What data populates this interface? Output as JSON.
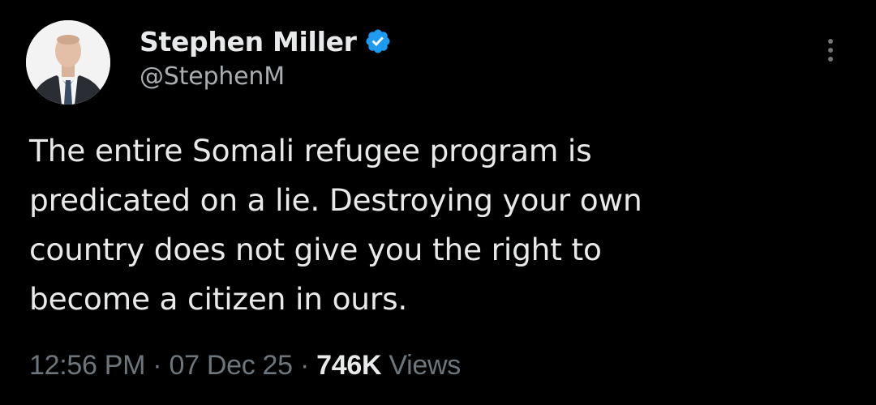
{
  "tweet": {
    "author": {
      "display_name": "Stephen Miller",
      "handle": "@StephenM",
      "verified": true,
      "verified_icon": "verified-badge-icon",
      "verified_color": "#1d9bf0"
    },
    "text_lines": [
      "The entire Somali refugee program is",
      "predicated on a lie. Destroying your own",
      "country does not give you the right to",
      "become a citizen in ours."
    ],
    "meta": {
      "time": "12:56 PM",
      "separator": "·",
      "date": "07 Dec 25",
      "views_count": "746K",
      "views_label": "Views"
    },
    "more_icon": "more-options-icon"
  },
  "colors": {
    "background": "#000000",
    "primary_text": "#e7e9ea",
    "secondary_text": "#71767b",
    "accent": "#1d9bf0"
  }
}
